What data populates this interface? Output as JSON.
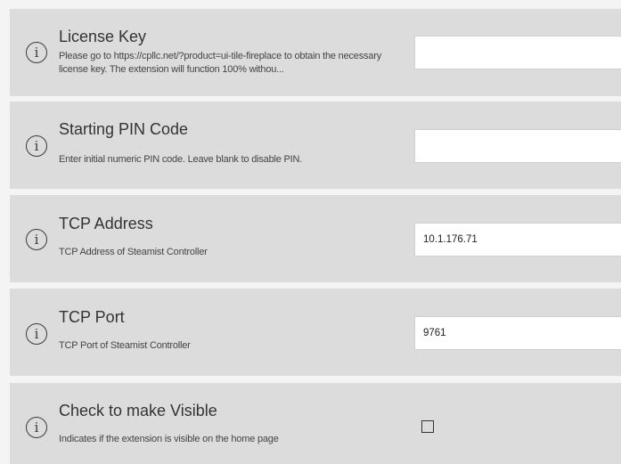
{
  "settings": [
    {
      "title": "License Key",
      "description": "Please go to https://cpllc.net/?product=ui-tile-fireplace to obtain the necessary license key. The extension will function 100% withou...",
      "value": "",
      "placeholder": ""
    },
    {
      "title": "Starting PIN Code",
      "description": "Enter initial numeric PIN code.  Leave blank to disable PIN.",
      "value": "",
      "placeholder": ""
    },
    {
      "title": "TCP Address",
      "description": "TCP Address of Steamist Controller",
      "value": "10.1.176.71",
      "placeholder": ""
    },
    {
      "title": "TCP Port",
      "description": "TCP Port of Steamist Controller",
      "value": "9761",
      "placeholder": ""
    },
    {
      "title": "Check to make Visible",
      "description": "Indicates if the extension is visible on the home page",
      "checked": false
    }
  ],
  "icons": {
    "info_glyph": "i"
  }
}
